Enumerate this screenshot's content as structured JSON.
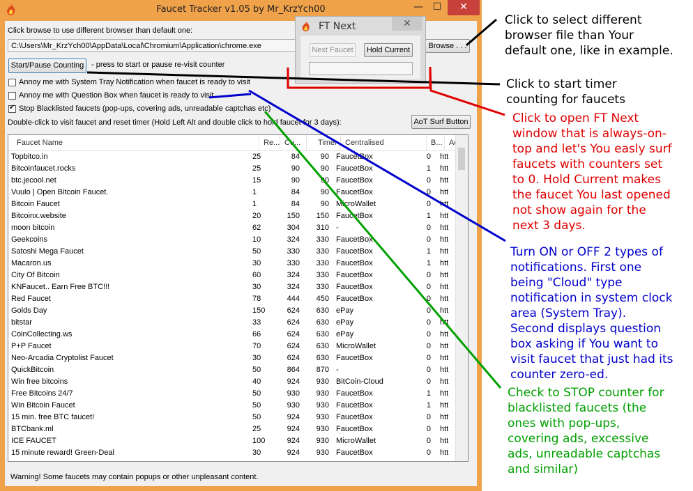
{
  "window": {
    "title": "Faucet Tracker v1.05 by Mr_KrzYch00",
    "minimize": "—",
    "maximize": "☐",
    "close": "✕",
    "icon": "flame-icon"
  },
  "browser": {
    "hint": "Click browse to use different browser than default one:",
    "path": "C:\\Users\\Mr_KrzYch00\\AppData\\Local\\Chromium\\Application\\chrome.exe",
    "browse_label": "Browse . . ."
  },
  "counter": {
    "start_pause_label": "Start/Pause Counting",
    "hint": "- press to start or pause re-visit counter"
  },
  "options": [
    {
      "label": "Annoy me with System Tray Notification when faucet is ready to visit",
      "checked": false
    },
    {
      "label": "Annoy me with Question Box when faucet is ready to visit",
      "checked": false
    },
    {
      "label": "Stop Blacklisted faucets (pop-ups, covering ads, unreadable captchas etc)",
      "checked": true
    }
  ],
  "visit_hint": "Double-click to visit faucet and reset timer (Hold Left Alt and double click to hold faucet for 3 days):",
  "aot_label": "AoT Surf Button",
  "table": {
    "columns": [
      "Faucet Name",
      "Re...",
      "Cu...",
      "Timer",
      "Centralised",
      "B...",
      "Ad"
    ],
    "rows": [
      [
        "Topbitco.in",
        "25",
        "84",
        "90",
        "FaucetBox",
        "0",
        "htt"
      ],
      [
        "Bitcoinfaucet.rocks",
        "25",
        "90",
        "90",
        "FaucetBox",
        "1",
        "htt"
      ],
      [
        "btc.jecool.net",
        "15",
        "90",
        "90",
        "FaucetBox",
        "0",
        "htt"
      ],
      [
        "Vuulo | Open Bitcoin Faucet.",
        "1",
        "84",
        "90",
        "FaucetBox",
        "0",
        "htt"
      ],
      [
        "Bitcoin Faucet",
        "1",
        "84",
        "90",
        "MicroWallet",
        "0",
        "htt"
      ],
      [
        "Bitcoinx.website",
        "20",
        "150",
        "150",
        "FaucetBox",
        "1",
        "htt"
      ],
      [
        "moon bitcoin",
        "62",
        "304",
        "310",
        "-",
        "0",
        "htt"
      ],
      [
        "Geekcoins",
        "10",
        "324",
        "330",
        "FaucetBox",
        "0",
        "htt"
      ],
      [
        "Satoshi Mega Faucet",
        "50",
        "330",
        "330",
        "FaucetBox",
        "1",
        "htt"
      ],
      [
        "Macaron.us",
        "30",
        "330",
        "330",
        "FaucetBox",
        "1",
        "htt"
      ],
      [
        "City Of Bitcoin",
        "60",
        "324",
        "330",
        "FaucetBox",
        "0",
        "htt"
      ],
      [
        "KNFaucet.. Earn Free BTC!!!",
        "30",
        "324",
        "330",
        "FaucetBox",
        "0",
        "htt"
      ],
      [
        "Red Faucet",
        "78",
        "444",
        "450",
        "FaucetBox",
        "0",
        "htt"
      ],
      [
        "Golds Day",
        "150",
        "624",
        "630",
        "ePay",
        "0",
        "htt"
      ],
      [
        "bitstar",
        "33",
        "624",
        "630",
        "ePay",
        "0",
        "htt"
      ],
      [
        "CoinCollecting.ws",
        "66",
        "624",
        "630",
        "ePay",
        "0",
        "htt"
      ],
      [
        "P+P Faucet",
        "70",
        "624",
        "630",
        "MicroWallet",
        "0",
        "htt"
      ],
      [
        "Neo-Arcadia Cryptolist Faucet",
        "30",
        "624",
        "630",
        "FaucetBox",
        "0",
        "htt"
      ],
      [
        "QuickBitcoin",
        "50",
        "864",
        "870",
        "-",
        "0",
        "htt"
      ],
      [
        "Win free bitcoins",
        "40",
        "924",
        "930",
        "BitCoin-Cloud",
        "0",
        "htt"
      ],
      [
        "Free Bitcoins 24/7",
        "50",
        "930",
        "930",
        "FaucetBox",
        "1",
        "htt"
      ],
      [
        "Win Bitcoin Faucet",
        "50",
        "930",
        "930",
        "FaucetBox",
        "1",
        "htt"
      ],
      [
        "15 min. free BTC faucet!",
        "50",
        "924",
        "930",
        "FaucetBox",
        "0",
        "htt"
      ],
      [
        "BTCbank.ml",
        "25",
        "924",
        "930",
        "FaucetBox",
        "0",
        "htt"
      ],
      [
        "ICE FAUCET",
        "100",
        "924",
        "930",
        "MicroWallet",
        "0",
        "htt"
      ],
      [
        "15 minute reward! Green-Deal",
        "30",
        "924",
        "930",
        "FaucetBox",
        "0",
        "htt"
      ]
    ]
  },
  "status": "Warning! Some faucets may contain popups or other unpleasant content.",
  "ft_next": {
    "title": "FT Next",
    "close": "✕",
    "next_label": "Next Faucet",
    "hold_label": "Hold Current",
    "current_value": ""
  },
  "annotations": {
    "browse": [
      "Click to select different",
      "browser file than Your",
      "default one, like in example."
    ],
    "start": [
      "Click to start timer",
      "counting for faucets"
    ],
    "ftnext": [
      "Click to open FT Next",
      "window that is always-on-",
      "top and let's You easly surf",
      "faucets with counters set",
      "to 0. Hold Current makes",
      "the faucet You last opened",
      "not show again for the",
      "next 3 days."
    ],
    "notify": [
      "Turn ON or OFF 2 types of",
      "notifications. First one",
      "being \"Cloud\" type",
      "notification in system clock",
      "area (System Tray).",
      "Second displays question",
      "box asking if You want to",
      "visit faucet that just had its",
      "counter zero-ed."
    ],
    "blacklist": [
      "Check to STOP counter for",
      "blacklisted faucets (the",
      "ones with pop-ups,",
      "covering ads, excessive",
      "ads, unreadable captchas",
      "and similar)"
    ]
  },
  "colors": {
    "window_frame": "#f0a24a",
    "close_button": "#c7403a",
    "annotation_black": "#000000",
    "annotation_red": "#e00000",
    "annotation_blue": "#0000cc",
    "annotation_green": "#00a000"
  }
}
